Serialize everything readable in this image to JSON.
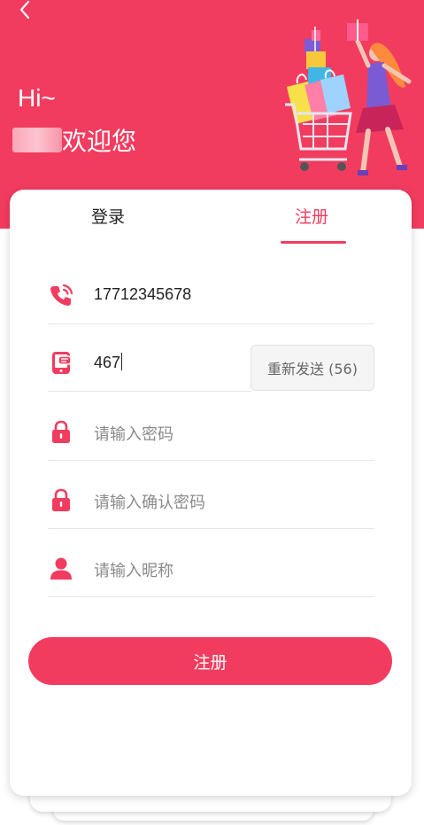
{
  "header": {
    "greeting": "Hi~",
    "welcome": "欢迎您",
    "accent_color": "#f23c5f",
    "back_icon": "chevron-left-icon",
    "illustration": "shopping-cart-gifts-illustration"
  },
  "tabs": [
    {
      "label": "登录",
      "active": false
    },
    {
      "label": "注册",
      "active": true
    }
  ],
  "form": {
    "phone": {
      "icon": "phone-icon",
      "value": "17712345678"
    },
    "code": {
      "icon": "sms-phone-icon",
      "value": "467",
      "resend_label": "重新发送 (56)"
    },
    "password": {
      "icon": "lock-icon",
      "placeholder": "请输入密码"
    },
    "confirm_password": {
      "icon": "lock-icon",
      "placeholder": "请输入确认密码"
    },
    "nickname": {
      "icon": "user-icon",
      "placeholder": "请输入昵称"
    },
    "submit_label": "注册"
  }
}
